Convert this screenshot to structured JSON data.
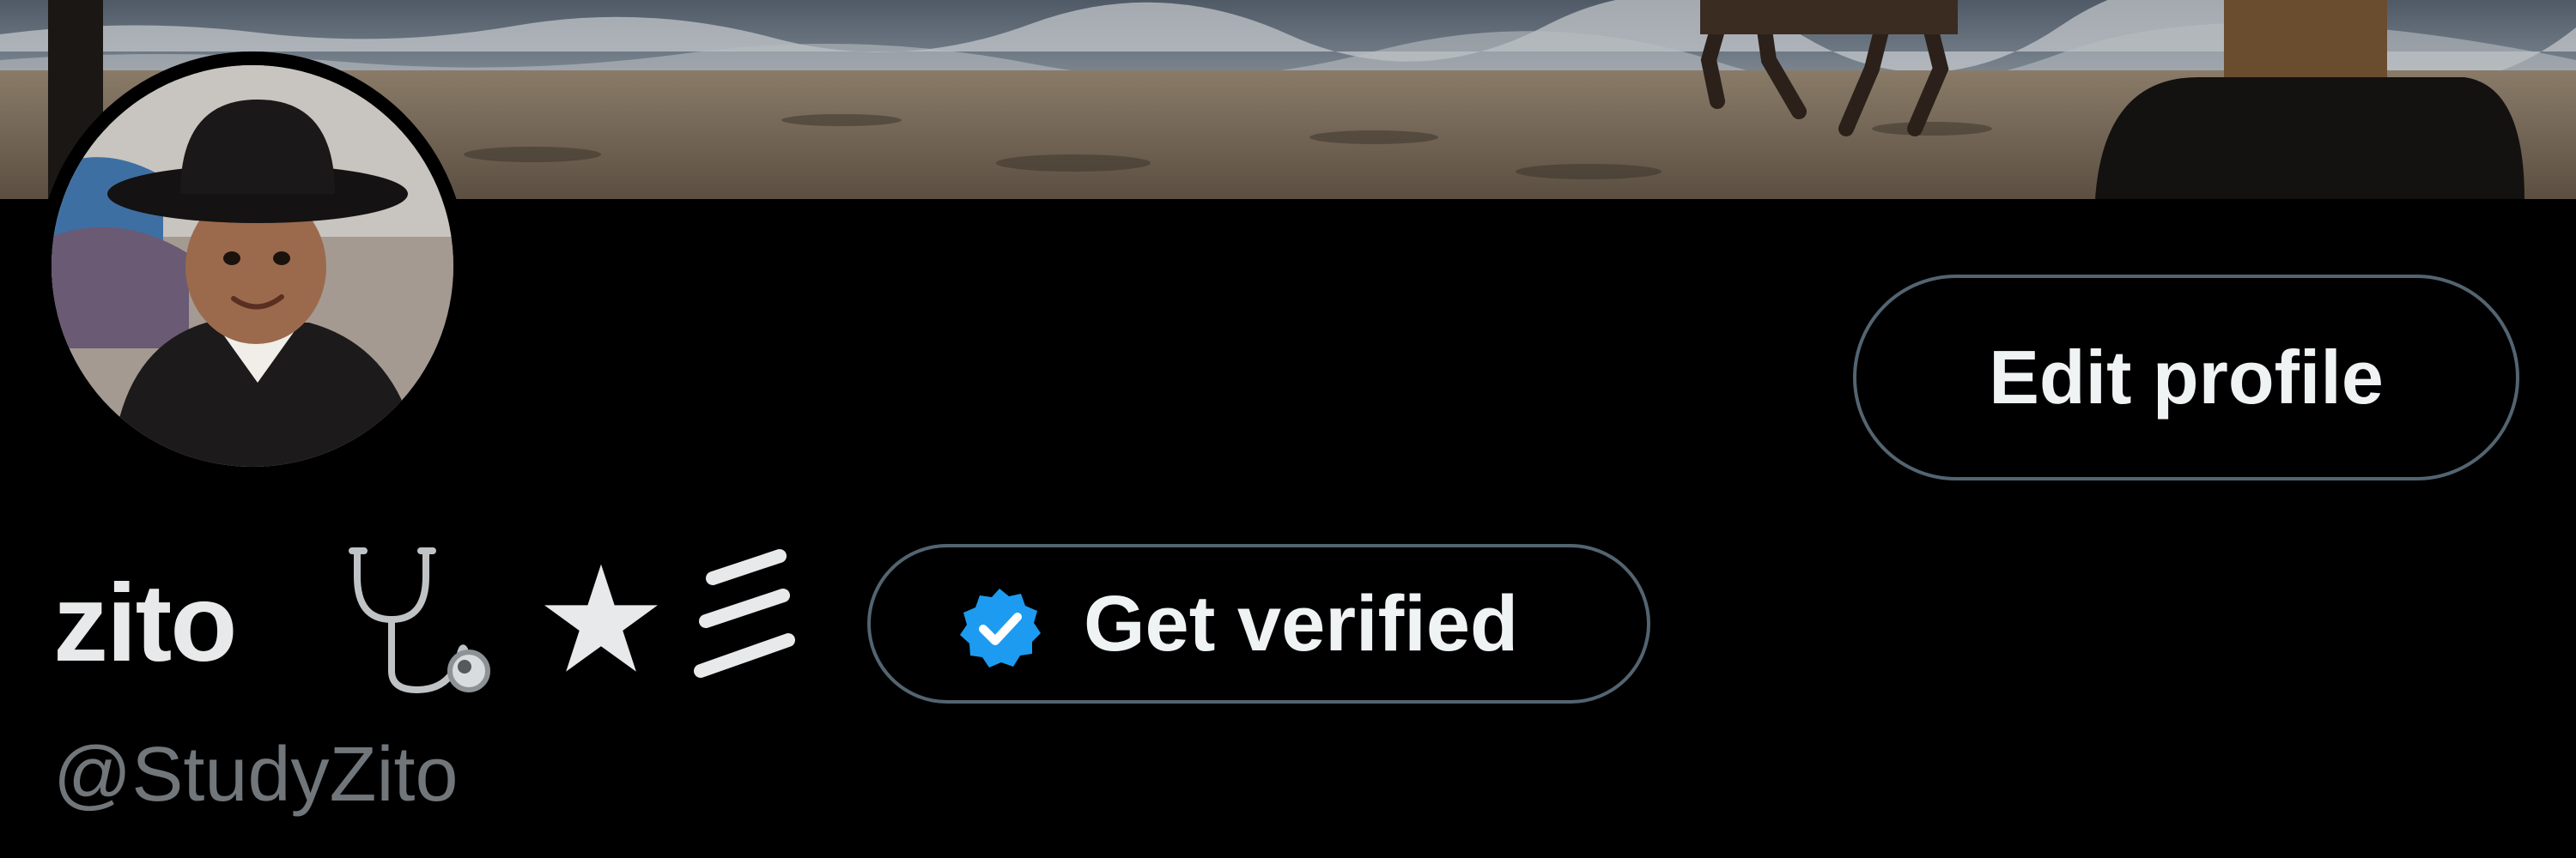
{
  "profile": {
    "display_name": "zito",
    "name_emojis": [
      "stethoscope-icon",
      "star-icon",
      "strokes-icon"
    ],
    "star_glyph": "★",
    "handle": "@StudyZito"
  },
  "buttons": {
    "edit_profile": "Edit profile",
    "get_verified": "Get verified"
  },
  "icons": {
    "verified_badge": "verified-badge-icon"
  },
  "colors": {
    "background": "#000000",
    "text_primary": "#e7e9ea",
    "text_secondary": "#71767b",
    "button_border": "#536471",
    "verified_blue": "#1d9bf0"
  }
}
